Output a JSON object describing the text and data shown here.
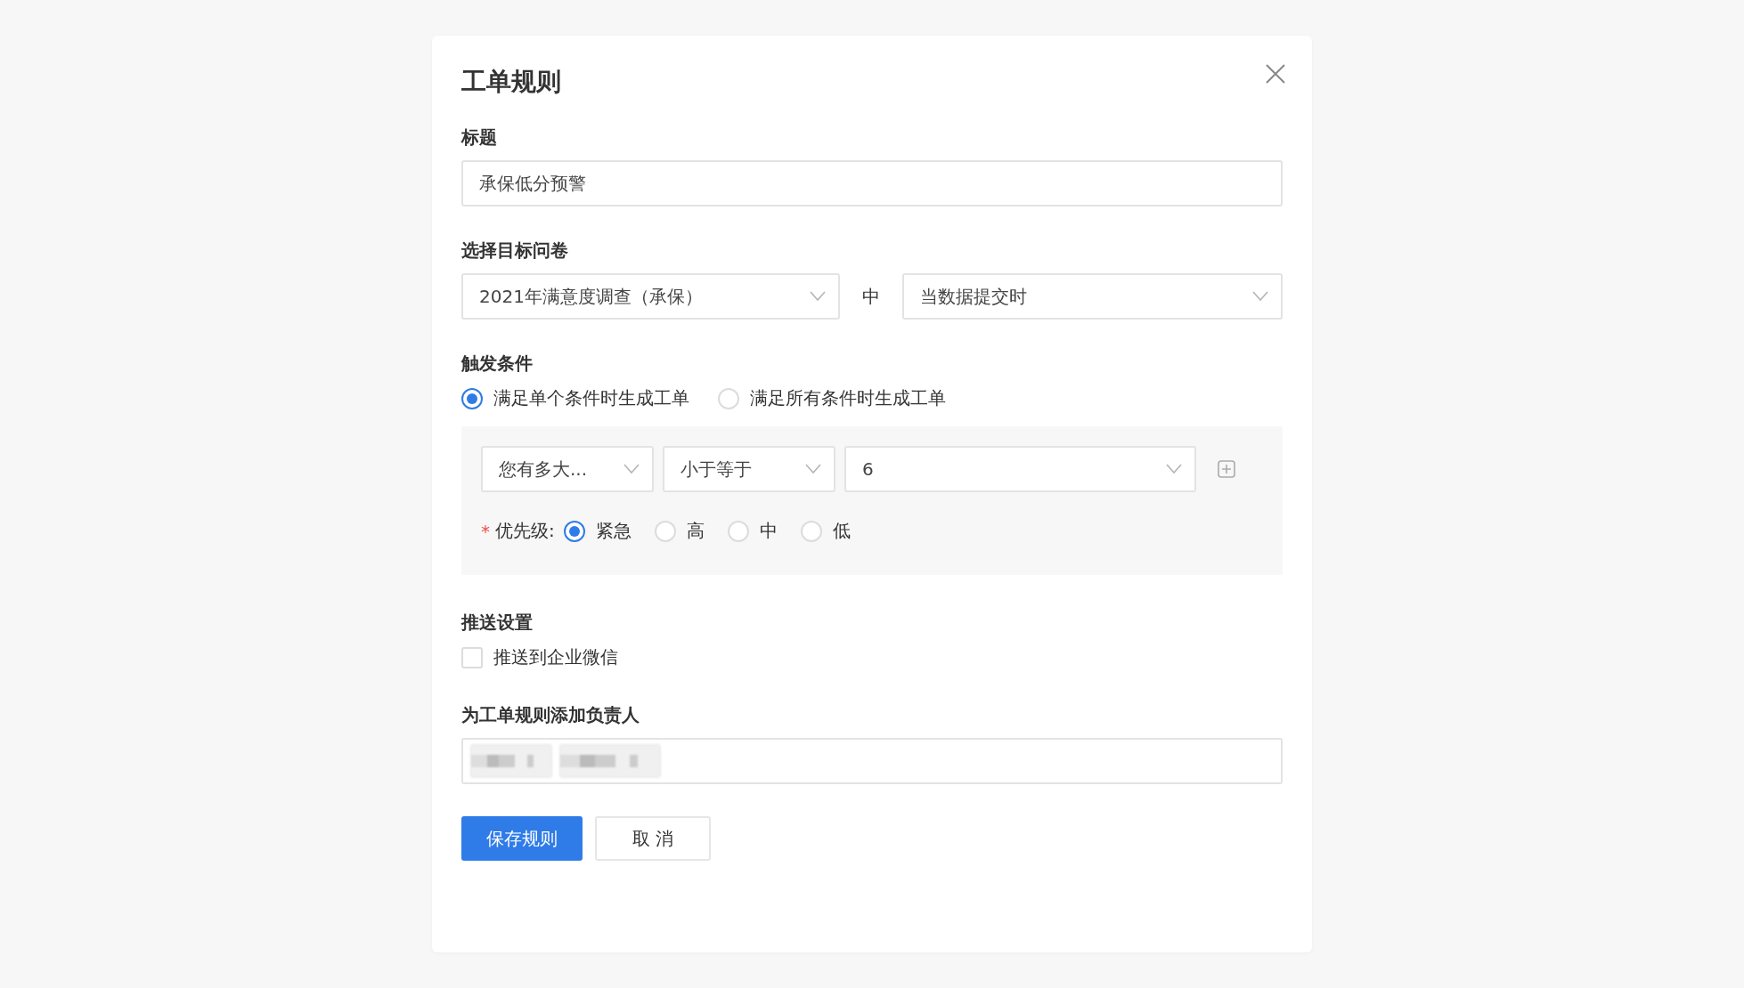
{
  "dialog": {
    "title": "工单规则"
  },
  "title_field": {
    "label": "标题",
    "value": "承保低分预警"
  },
  "target": {
    "label": "选择目标问卷",
    "survey": "2021年满意度调查（承保）",
    "joiner": "中",
    "event": "当数据提交时"
  },
  "trigger": {
    "label": "触发条件",
    "modes": [
      {
        "label": "满足单个条件时生成工单",
        "selected": true
      },
      {
        "label": "满足所有条件时生成工单",
        "selected": false
      }
    ],
    "condition": {
      "question": "您有多大...",
      "operator": "小于等于",
      "value": "6"
    },
    "priority": {
      "required_mark": "*",
      "label": "优先级:",
      "options": [
        {
          "label": "紧急",
          "selected": true
        },
        {
          "label": "高",
          "selected": false
        },
        {
          "label": "中",
          "selected": false
        },
        {
          "label": "低",
          "selected": false
        }
      ]
    }
  },
  "push": {
    "label": "推送设置",
    "wecom": {
      "label": "推送到企业微信",
      "checked": false
    }
  },
  "owners": {
    "label": "为工单规则添加负责人",
    "tags": [
      {
        "kind": "redacted"
      },
      {
        "kind": "redacted"
      }
    ]
  },
  "buttons": [
    {
      "label": "保存规则",
      "kind": "primary"
    },
    {
      "label": "取 消",
      "kind": "default"
    }
  ]
}
